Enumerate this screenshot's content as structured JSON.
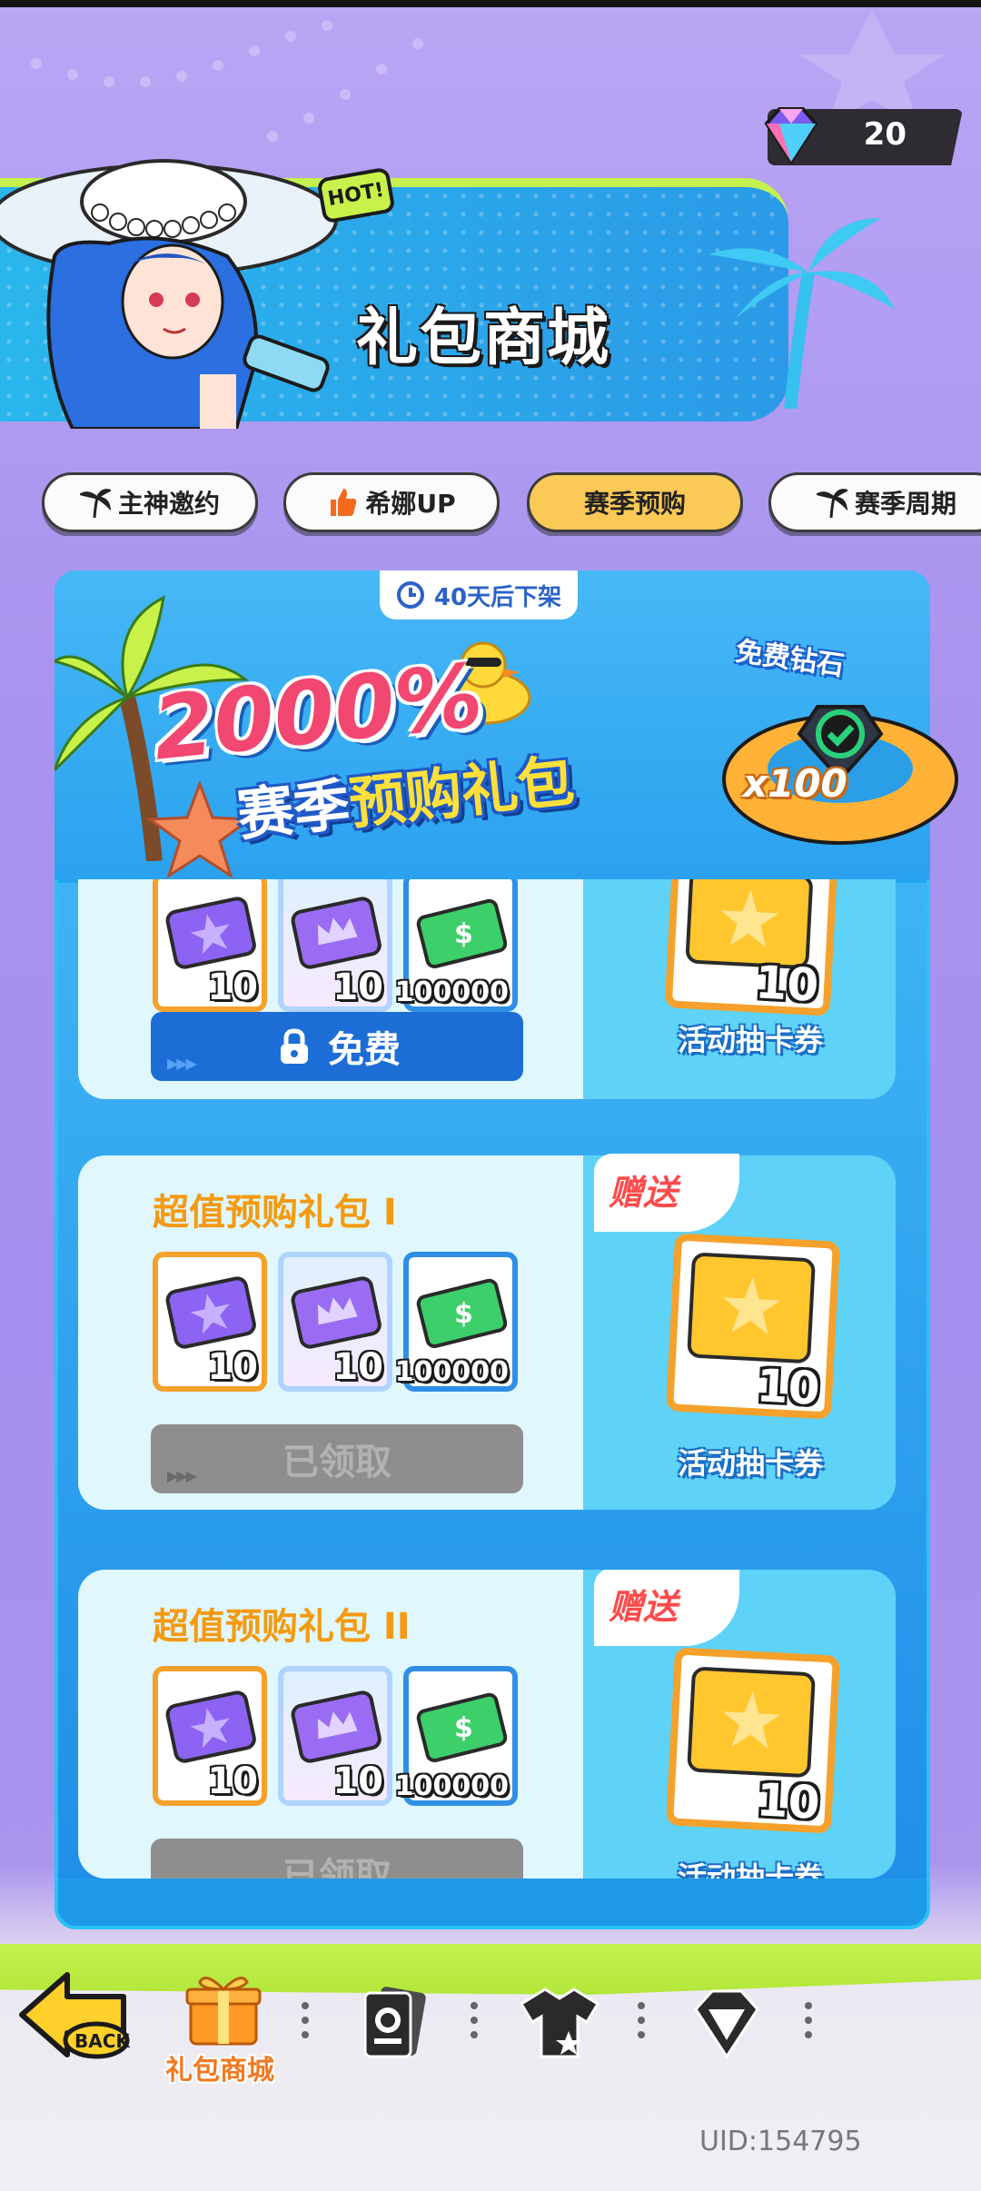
{
  "currency": {
    "gems": "20"
  },
  "banner": {
    "title": "礼包商城",
    "badge": "HOT!"
  },
  "tabs": [
    {
      "label": "主神邀约",
      "active": false
    },
    {
      "label": "希娜UP",
      "active": false
    },
    {
      "label": "赛季预购",
      "active": true
    },
    {
      "label": "赛季周期",
      "active": false
    }
  ],
  "promo": {
    "deadline": "40天后下架",
    "percent": "2000%",
    "title_a": "赛季",
    "title_b": "预购礼包",
    "free_gem_label": "免费钻石",
    "free_gem_qty": "x100"
  },
  "packs": [
    {
      "title": "",
      "items": [
        "10",
        "10",
        "100000"
      ],
      "button": "免费",
      "button_state": "free",
      "gift_label": "",
      "ticket_qty": "10",
      "ticket_label": "活动抽卡券"
    },
    {
      "title": "超值预购礼包 I",
      "items": [
        "10",
        "10",
        "100000"
      ],
      "button": "已领取",
      "button_state": "claimed",
      "gift_label": "赠送",
      "ticket_qty": "10",
      "ticket_label": "活动抽卡券"
    },
    {
      "title": "超值预购礼包 II",
      "items": [
        "10",
        "10",
        "100000"
      ],
      "button": "已领取",
      "button_state": "claimed",
      "gift_label": "赠送",
      "ticket_qty": "10",
      "ticket_label": "活动抽卡券"
    }
  ],
  "nav": {
    "back_label": "BACK",
    "gift_shop_label": "礼包商城"
  },
  "uid": "UID:154795",
  "colors": {
    "accent": "#fbc955",
    "panel": "#1fa6ee",
    "lime": "#c5f14e",
    "gift_red": "#fd4b4b",
    "title_orange": "#f59a10"
  }
}
